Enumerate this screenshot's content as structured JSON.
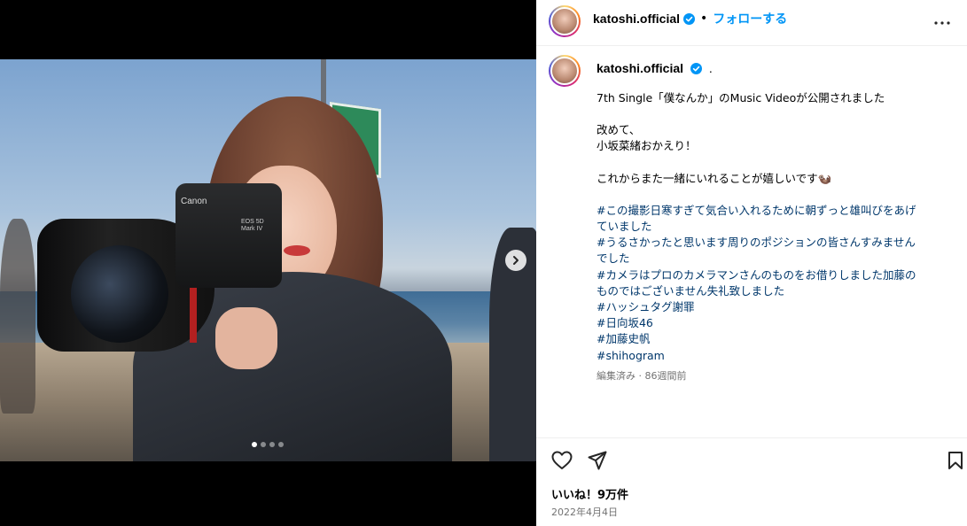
{
  "post": {
    "username": "katoshi.official",
    "follow_label": "フォローする",
    "separator": "•",
    "caption_suffix": ".",
    "caption_lines": [
      {
        "text": "7th Single「僕なんか」のMusic Videoが公開されました",
        "type": "text"
      },
      {
        "text": "",
        "type": "blank"
      },
      {
        "text": "改めて、",
        "type": "text"
      },
      {
        "text": "小坂菜緒おかえり！",
        "type": "text"
      },
      {
        "text": "",
        "type": "blank"
      },
      {
        "text": "これからまた一緒にいれることが嬉しいです🦦",
        "type": "text"
      },
      {
        "text": "",
        "type": "blank"
      },
      {
        "text": "#この撮影日寒すぎて気合い入れるために朝ずっと雄叫びをあげ",
        "type": "hashtag"
      },
      {
        "text": "ていました",
        "type": "hashtag"
      },
      {
        "text": "#うるさかったと思います周りのポジションの皆さんすみません",
        "type": "hashtag"
      },
      {
        "text": "でした",
        "type": "hashtag"
      },
      {
        "text": "#カメラはプロのカメラマンさんのものをお借りしました加藤の",
        "type": "hashtag"
      },
      {
        "text": "ものではございません失礼致しました",
        "type": "hashtag"
      },
      {
        "text": "#ハッシュタグ謝罪",
        "type": "hashtag"
      },
      {
        "text": "#日向坂46",
        "type": "hashtag"
      },
      {
        "text": "#加藤史帆",
        "type": "hashtag"
      },
      {
        "text": "#shihogram",
        "type": "hashtag"
      }
    ],
    "edited_meta": "編集済み · 86週間前",
    "likes": "いいね！9万件",
    "date": "2022年4月4日"
  },
  "photo": {
    "camera_brand": "Canon",
    "camera_model": "EOS 5D Mark IV",
    "carousel_count": 4,
    "carousel_active": 0
  },
  "colors": {
    "link": "#0095f6",
    "hashtag": "#00376b",
    "verified": "#0095f6",
    "muted": "#737373"
  },
  "icons": {
    "verified": "verified-badge-icon",
    "more": "more-options-icon",
    "like": "heart-icon",
    "share": "paper-plane-icon",
    "save": "bookmark-icon",
    "next": "chevron-right-icon"
  }
}
